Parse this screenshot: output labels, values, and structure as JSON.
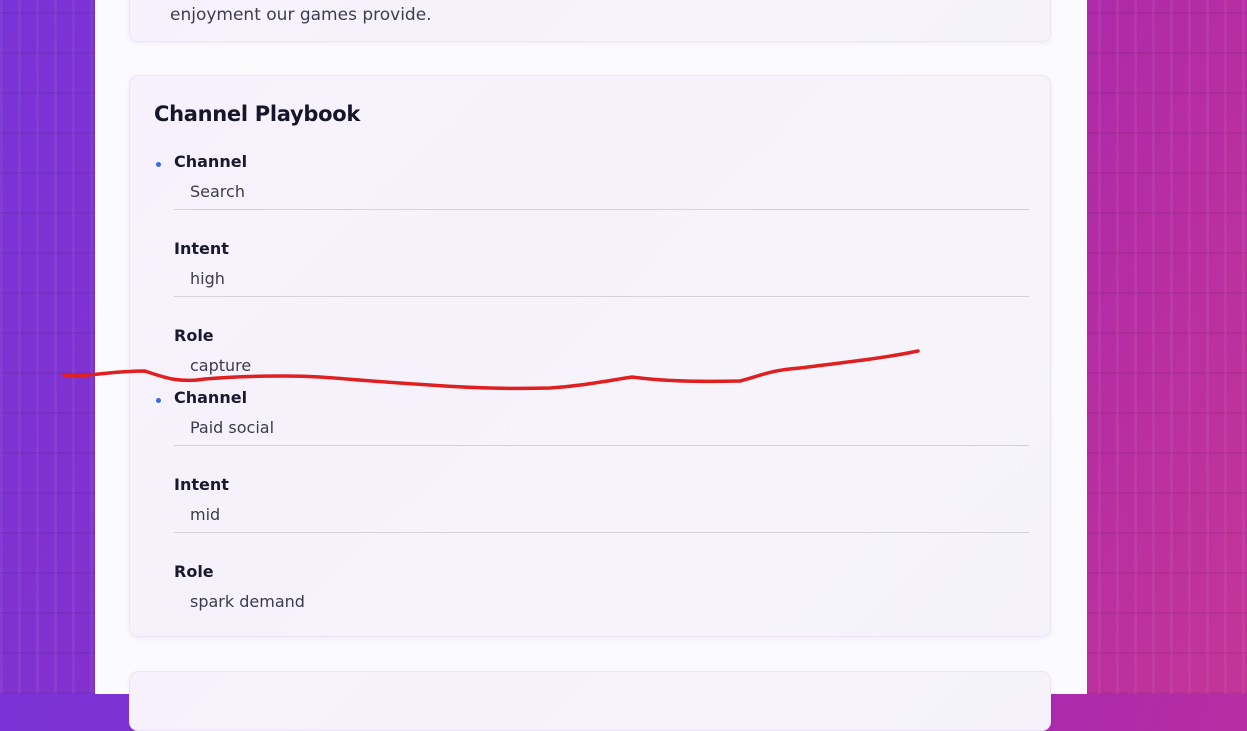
{
  "intro_card": {
    "tail_text": "enjoyment our games provide."
  },
  "playbook": {
    "title": "Channel Playbook",
    "entries": [
      {
        "fields": [
          {
            "label": "Channel",
            "value": "Search"
          },
          {
            "label": "Intent",
            "value": "high"
          },
          {
            "label": "Role",
            "value": "capture"
          }
        ]
      },
      {
        "fields": [
          {
            "label": "Channel",
            "value": "Paid social"
          },
          {
            "label": "Intent",
            "value": "mid"
          },
          {
            "label": "Role",
            "value": "spark demand"
          }
        ]
      }
    ]
  },
  "colors": {
    "bullet": "#3a6ee0",
    "annotation_stroke": "#e02020",
    "background_left": "#7a33d6",
    "background_right": "#c43598"
  }
}
